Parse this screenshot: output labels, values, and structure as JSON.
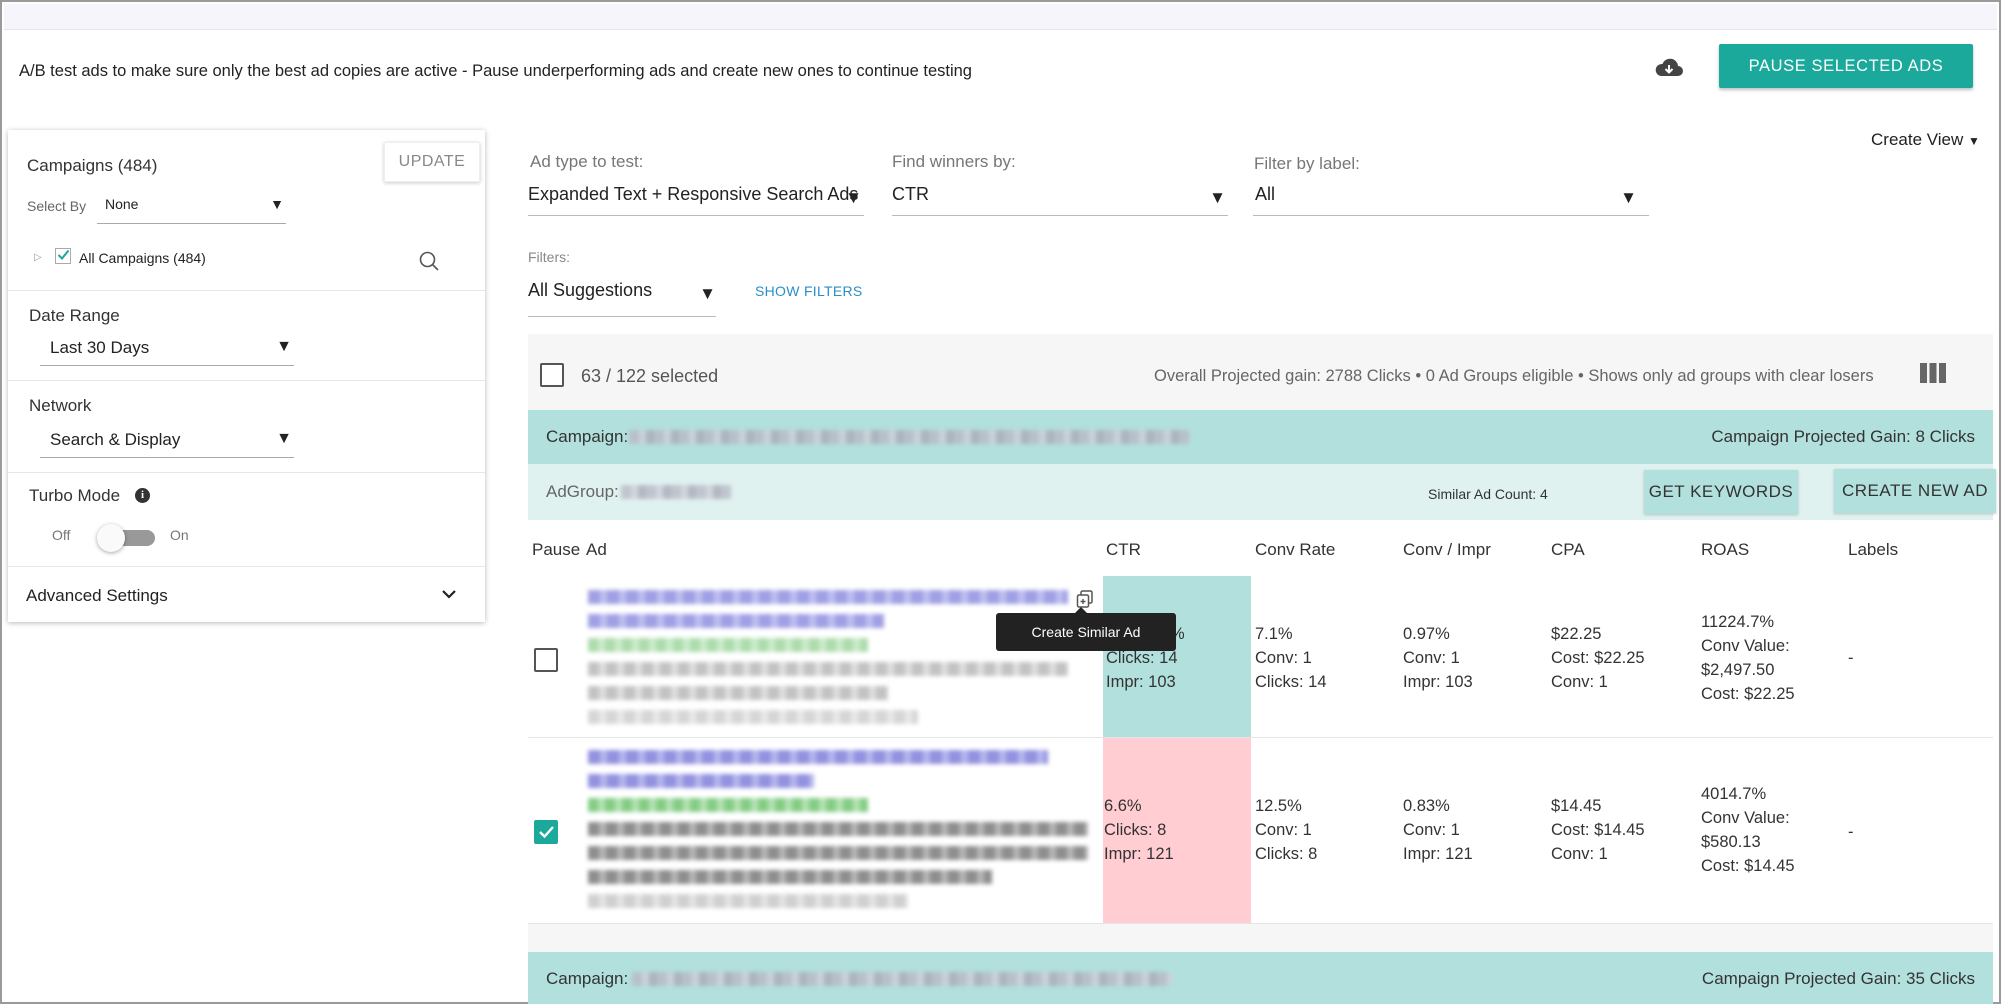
{
  "header": {
    "intro": "A/B test ads to make sure only the best ad copies are active - Pause underperforming ads and create new ones to continue testing",
    "pause_button": "PAUSE SELECTED ADS"
  },
  "sidebar": {
    "campaigns_title": "Campaigns (484)",
    "update_button": "UPDATE",
    "select_by_label": "Select By",
    "select_by_value": "None",
    "all_campaigns": "All Campaigns (484)",
    "date_range_label": "Date Range",
    "date_range_value": "Last 30 Days",
    "network_label": "Network",
    "network_value": "Search & Display",
    "turbo_label": "Turbo Mode",
    "turbo_off": "Off",
    "turbo_on": "On",
    "advanced_settings": "Advanced Settings"
  },
  "filters": {
    "ad_type_label": "Ad type to test:",
    "ad_type_value": "Expanded Text + Responsive Search Ads",
    "winners_label": "Find winners by:",
    "winners_value": "CTR",
    "label_filter_label": "Filter by label:",
    "label_filter_value": "All",
    "filters_label": "Filters:",
    "filters_value": "All Suggestions",
    "show_filters": "SHOW FILTERS",
    "create_view": "Create View"
  },
  "summary": {
    "selected": "63 / 122 selected",
    "overall": "Overall Projected gain: 2788 Clicks • 0 Ad Groups eligible • Shows only ad groups with clear losers"
  },
  "campaigns": [
    {
      "label": "Campaign:",
      "gain": "Campaign Projected Gain: 8 Clicks"
    },
    {
      "label": "Campaign:",
      "gain": "Campaign Projected Gain: 35 Clicks"
    }
  ],
  "adgroup": {
    "label": "AdGroup:",
    "similar_count": "Similar Ad Count: 4",
    "get_keywords": "GET KEYWORDS",
    "create_new_ad": "CREATE NEW AD"
  },
  "table": {
    "headers": [
      "Pause",
      "Ad",
      "CTR",
      "Conv Rate",
      "Conv / Impr",
      "CPA",
      "ROAS",
      "Labels"
    ],
    "rows": [
      {
        "checked": false,
        "ctr_color": "#b2e0dc",
        "ctr": [
          "%",
          "Clicks: 14",
          "Impr: 103"
        ],
        "conv_rate": [
          "7.1%",
          "Conv: 1",
          "Clicks: 14"
        ],
        "conv_impr": [
          "0.97%",
          "Conv: 1",
          "Impr: 103"
        ],
        "cpa": [
          "$22.25",
          "Cost: $22.25",
          "Conv: 1"
        ],
        "roas": [
          "11224.7%",
          "Conv Value:",
          "$2,497.50",
          "Cost: $22.25"
        ],
        "labels": "-"
      },
      {
        "checked": true,
        "ctr_color": "#ffcdd2",
        "ctr": [
          "6.6%",
          "Clicks: 8",
          "Impr: 121"
        ],
        "conv_rate": [
          "12.5%",
          "Conv: 1",
          "Clicks: 8"
        ],
        "conv_impr": [
          "0.83%",
          "Conv: 1",
          "Impr: 121"
        ],
        "cpa": [
          "$14.45",
          "Cost: $14.45",
          "Conv: 1"
        ],
        "roas": [
          "4014.7%",
          "Conv Value:",
          "$580.13",
          "Cost: $14.45"
        ],
        "labels": "-"
      }
    ]
  },
  "tooltip": "Create Similar Ad",
  "colors": {
    "accent": "#1aa99b",
    "campaign_bar": "#b2e0dc",
    "adgroup_bar": "#e0f2f0",
    "winner": "#b2e0dc",
    "loser": "#ffcdd2"
  },
  "icons": [
    "cloud-download-icon",
    "search-icon",
    "info-icon",
    "chevron-down-icon",
    "columns-icon",
    "copy-icon",
    "check-icon"
  ]
}
